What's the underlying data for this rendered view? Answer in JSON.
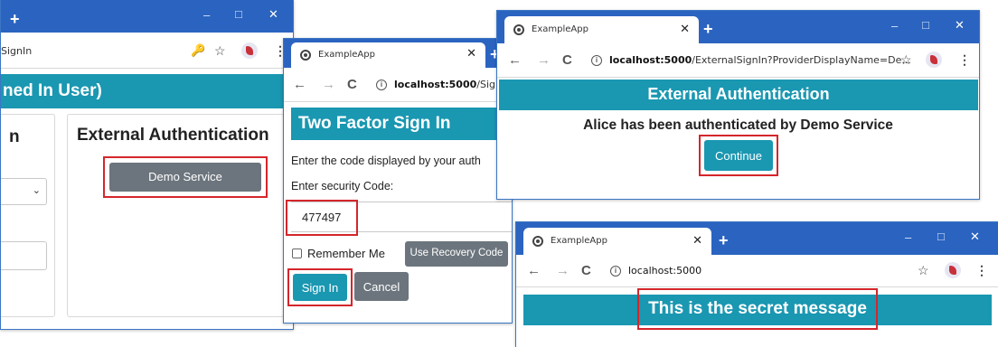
{
  "windows": {
    "login": {
      "address": "SignIn",
      "header_text": "ned In User)",
      "left_heading": "n",
      "ext_heading": "External Authentication",
      "demo_button": "Demo Service",
      "new_tab": "+",
      "key_icon": "key-icon",
      "controls": {
        "minimize": "–",
        "maximize": "□",
        "close": "✕"
      }
    },
    "two_factor": {
      "tab_title": "ExampleApp",
      "tab_close": "✕",
      "new_tab": "+",
      "address_host": "localhost:5000",
      "address_path": "/SignIn",
      "heading": "Two Factor Sign In",
      "instruction": "Enter the code displayed by your auth",
      "code_label": "Enter security Code:",
      "code_value": "477497",
      "remember_label": "Remember Me",
      "recovery_button": "Use Recovery Code",
      "signin_button": "Sign In",
      "cancel_button": "Cancel"
    },
    "external_auth": {
      "tab_title": "ExampleApp",
      "tab_close": "✕",
      "new_tab": "+",
      "address_host": "localhost:5000",
      "address_path": "/ExternalSignIn?ProviderDisplayName=De...",
      "heading": "External Authentication",
      "message": "Alice has been authenticated by Demo Service",
      "continue_button": "Continue",
      "controls": {
        "minimize": "–",
        "maximize": "□",
        "close": "✕"
      }
    },
    "secret": {
      "tab_title": "ExampleApp",
      "tab_close": "✕",
      "new_tab": "+",
      "address_host": "localhost:5000",
      "message": "This is the secret message",
      "controls": {
        "minimize": "–",
        "maximize": "□",
        "close": "✕"
      }
    }
  },
  "browser": {
    "back": "←",
    "forward": "→",
    "reload": "C",
    "info": "i",
    "star": "☆",
    "menu": "⋮"
  },
  "colors": {
    "titlebar": "#2b64c0",
    "banner": "#1a97b1",
    "highlight": "#d4262c",
    "gray_button": "#6c757d"
  }
}
